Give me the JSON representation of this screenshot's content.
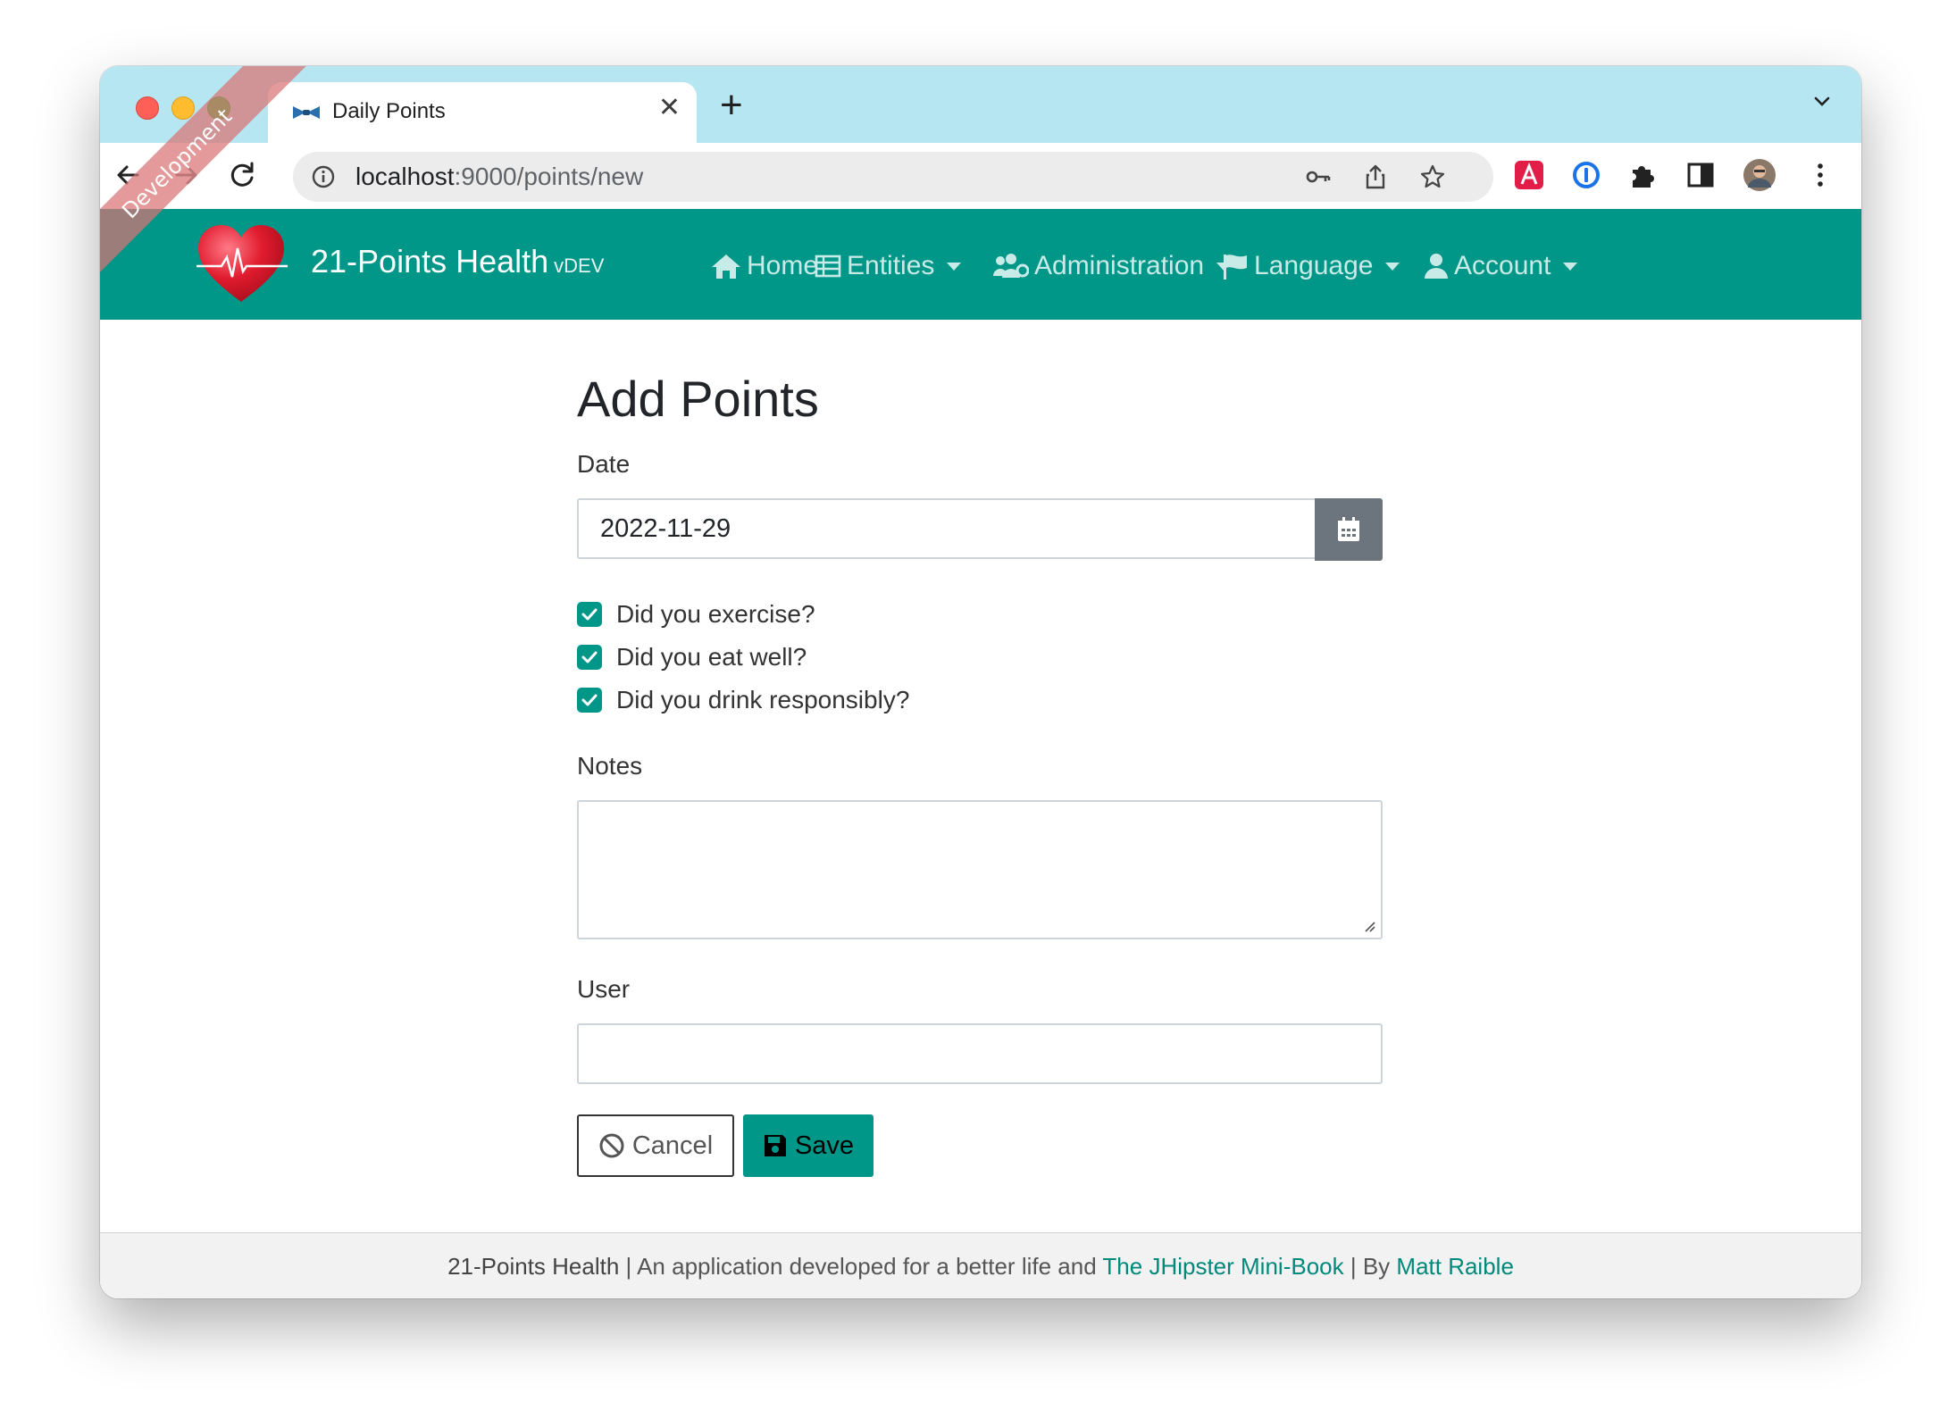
{
  "browser": {
    "tab_title": "Daily Points",
    "url_host": "localhost",
    "url_rest": ":9000/points/new"
  },
  "app": {
    "brand": "21-Points Health",
    "version": "vDEV",
    "ribbon": "Development",
    "nav": {
      "home": "Home",
      "entities": "Entities",
      "administration": "Administration",
      "language": "Language",
      "account": "Account"
    }
  },
  "form": {
    "title": "Add Points",
    "date_label": "Date",
    "date_value": "2022-11-29",
    "checks": {
      "exercise": "Did you exercise?",
      "meals": "Did you eat well?",
      "alcohol": "Did you drink responsibly?"
    },
    "notes_label": "Notes",
    "user_label": "User",
    "cancel": "Cancel",
    "save": "Save"
  },
  "footer": {
    "app_name": "21-Points Health",
    "text1": " | An application developed for a better life and ",
    "book": "The JHipster Mini-Book",
    "text2": " | By ",
    "author": "Matt Raible"
  },
  "colors": {
    "primary": "#009688",
    "tab_strip": "#b6e6f1",
    "secondary": "#6c757d",
    "ribbon": "#d97373"
  }
}
